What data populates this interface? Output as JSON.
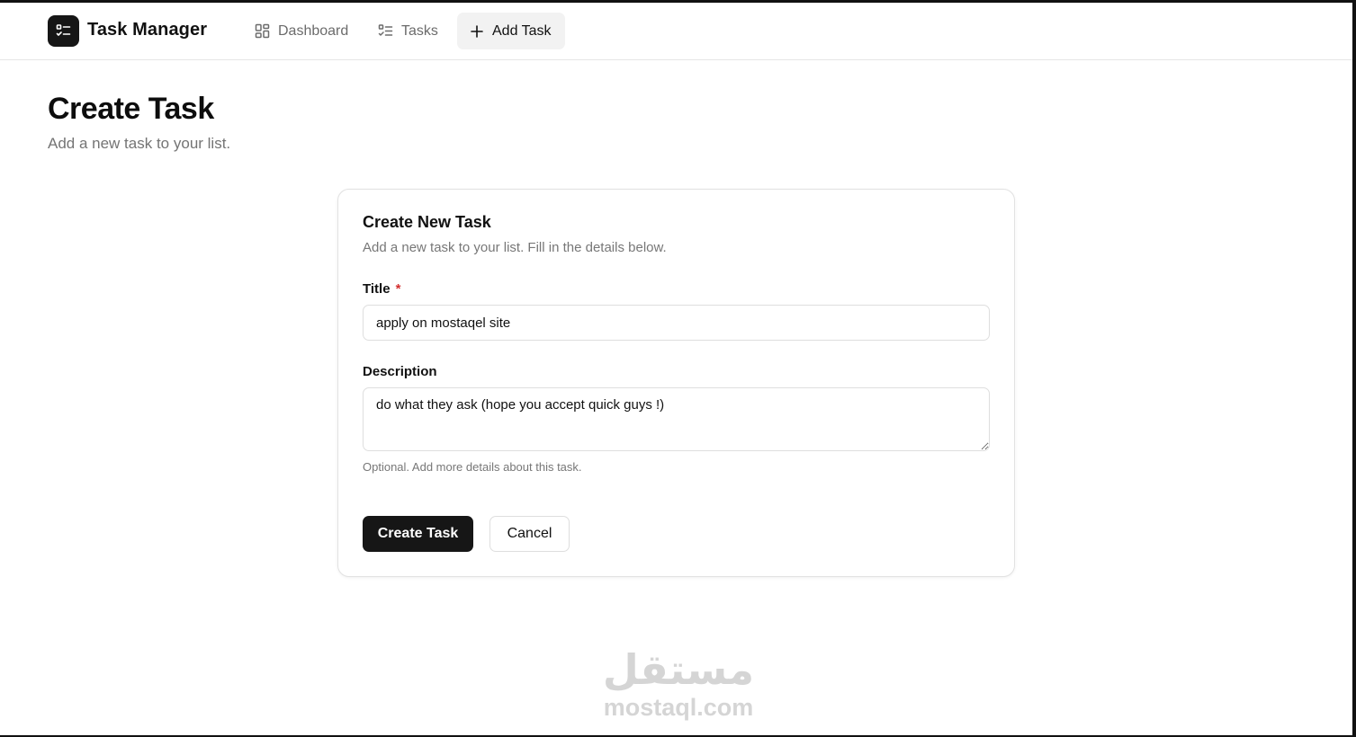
{
  "header": {
    "app_title": "Task Manager",
    "logo_icon": "list-check-icon",
    "nav": [
      {
        "label": "Dashboard",
        "icon": "dashboard-grid-icon"
      },
      {
        "label": "Tasks",
        "icon": "list-icon"
      },
      {
        "label": "Add Task",
        "icon": "plus-icon",
        "active": true
      }
    ]
  },
  "page": {
    "title": "Create Task",
    "subtitle": "Add a new task to your list."
  },
  "form": {
    "card_title": "Create New Task",
    "card_description": "Add a new task to your list. Fill in the details below.",
    "title_label": "Title",
    "title_required_mark": "*",
    "title_value": "apply on mostaqel site",
    "description_label": "Description",
    "description_value": "do what they ask (hope you accept quick guys !)",
    "description_helper": "Optional. Add more details about this task.",
    "submit_label": "Create Task",
    "cancel_label": "Cancel"
  },
  "watermark": {
    "arabic": "مستقل",
    "latin": "mostaql.com"
  },
  "colors": {
    "primary": "#161616",
    "required": "#d32f2f",
    "muted_text": "#777777",
    "border": "#dedede"
  }
}
